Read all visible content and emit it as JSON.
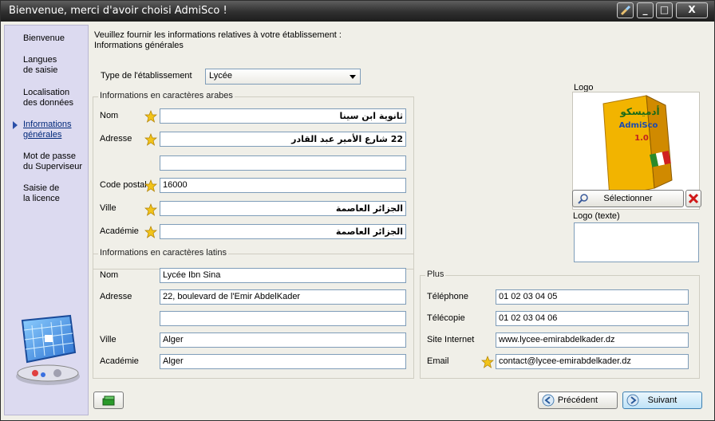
{
  "window": {
    "title": "Bienvenue, merci d'avoir choisi AdmiSco !",
    "controls": {
      "minimize": "_",
      "maximize": "□",
      "close": "X"
    }
  },
  "sidebar": {
    "items": [
      {
        "label": "Bienvenue"
      },
      {
        "label": "Langues\nde saisie"
      },
      {
        "label": "Localisation\ndes données"
      },
      {
        "label": "Informations\ngénérales"
      },
      {
        "label": "Mot de passe\ndu Superviseur"
      },
      {
        "label": "Saisie de\nla licence"
      }
    ],
    "active_index": 3
  },
  "header": {
    "line1": "Veuillez fournir les informations relatives à votre établissement :",
    "line2": "Informations générales"
  },
  "type_etablissement": {
    "label": "Type de l'établissement",
    "value": "Lycée"
  },
  "arabic_group": {
    "title": "Informations en caractères arabes",
    "nom_label": "Nom",
    "nom_value": "ثانوية ابن سينا",
    "adresse_label": "Adresse",
    "adresse_value": "22 شارع الأمير عبد القادر",
    "adresse2_value": "",
    "code_postal_label": "Code postal",
    "code_postal_value": "16000",
    "ville_label": "Ville",
    "ville_value": "الجزائر العاصمة",
    "academie_label": "Académie",
    "academie_value": "الجزائر العاصمة"
  },
  "latin_group": {
    "title": "Informations en caractères latins",
    "nom_label": "Nom",
    "nom_value": "Lycée Ibn Sina",
    "adresse_label": "Adresse",
    "adresse_value": "22, boulevard de l'Emir AbdelKader",
    "adresse2_value": "",
    "ville_label": "Ville",
    "ville_value": "Alger",
    "academie_label": "Académie",
    "academie_value": "Alger"
  },
  "plus_group": {
    "title": "Plus",
    "telephone_label": "Téléphone",
    "telephone_value": "01 02 03 04 05",
    "telecopie_label": "Télécopie",
    "telecopie_value": "01 02 03 04 06",
    "site_label": "Site Internet",
    "site_value": "www.lycee-emirabdelkader.dz",
    "email_label": "Email",
    "email_value": "contact@lycee-emirabdelkader.dz"
  },
  "logo": {
    "label": "Logo",
    "box_text_top": "أدميسكو",
    "box_text_brand": "AdmiSco",
    "box_text_version": "1.0",
    "select_button": "Sélectionner",
    "text_label": "Logo (texte)",
    "text_value": ""
  },
  "footer": {
    "previous_label": "Précédent",
    "next_label": "Suivant"
  }
}
